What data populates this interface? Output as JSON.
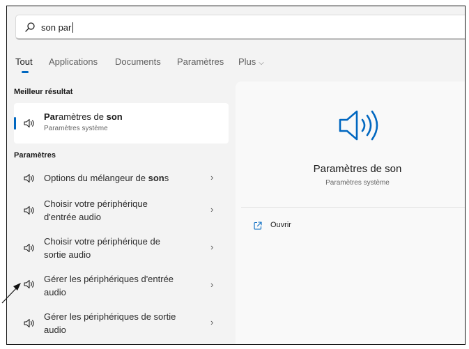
{
  "search": {
    "value": "son par"
  },
  "tabs": [
    {
      "label": "Tout"
    },
    {
      "label": "Applications"
    },
    {
      "label": "Documents"
    },
    {
      "label": "Paramètres"
    },
    {
      "label": "Plus"
    }
  ],
  "best_match": {
    "heading": "Meilleur résultat",
    "title_prefix": "Par",
    "title_mid": "amètres de ",
    "title_bold": "son",
    "subtitle": "Paramètres système"
  },
  "settings": {
    "heading": "Paramètres",
    "items": [
      {
        "label_pre": "Options du mélangeur de ",
        "label_bold": "son",
        "label_post": "s"
      },
      {
        "label": "Choisir votre périphérique d'entrée audio"
      },
      {
        "label": "Choisir votre périphérique de sortie audio"
      },
      {
        "label": "Gérer les périphériques d'entrée audio"
      },
      {
        "label": "Gérer les périphériques de sortie audio"
      }
    ]
  },
  "preview": {
    "title": "Paramètres de son",
    "subtitle": "Paramètres système",
    "open_label": "Ouvrir"
  },
  "colors": {
    "accent": "#0067c0",
    "panel": "#f3f3f3"
  },
  "icons": [
    "search-icon",
    "speaker-icon",
    "chevron-right-icon",
    "chevron-down-icon",
    "open-external-icon"
  ]
}
